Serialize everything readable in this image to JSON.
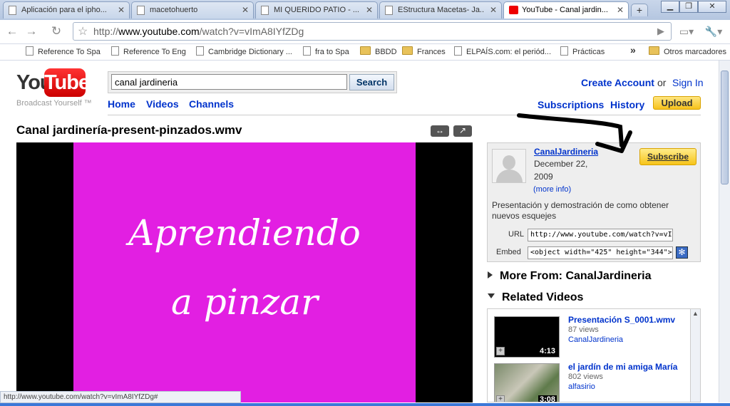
{
  "browser": {
    "tabs": [
      {
        "title": "Aplicación para el ipho...",
        "active": false
      },
      {
        "title": "macetohuerto",
        "active": false
      },
      {
        "title": "MI QUERIDO PATIO - ...",
        "active": false
      },
      {
        "title": "EStructura Macetas- Ja...",
        "active": false
      },
      {
        "title": "YouTube - Canal jardin...",
        "active": true
      }
    ],
    "new_tab_label": "+",
    "url_prefix": "http://",
    "url_domain": "www.youtube.com",
    "url_path": "/watch?v=vImA8IYfZDg",
    "bookmarks": [
      {
        "label": "Reference To Spa",
        "icon": "page-icon"
      },
      {
        "label": "Reference To Eng",
        "icon": "page-icon"
      },
      {
        "label": "Cambridge Dictionary ...",
        "icon": "page-icon"
      },
      {
        "label": "fra to Spa",
        "icon": "page-icon"
      },
      {
        "label": "BBDD",
        "icon": "folder-icon"
      },
      {
        "label": "Frances",
        "icon": "folder-icon"
      },
      {
        "label": "ELPAÍS.com: el periód...",
        "icon": "page-icon"
      },
      {
        "label": "Prácticas",
        "icon": "page-icon"
      }
    ],
    "bookmarks_overflow": "»",
    "other_bookmarks": "Otros marcadores",
    "status_text": "http://www.youtube.com/watch?v=vImA8IYfZDg#"
  },
  "youtube": {
    "logo_you": "You",
    "logo_tube": "Tube",
    "tagline": "Broadcast Yourself ™",
    "search_value": "canal jardineria",
    "search_button": "Search",
    "nav": [
      "Home",
      "Videos",
      "Channels"
    ],
    "create_account": "Create Account",
    "or": "or",
    "sign_in": "Sign In",
    "subscriptions": "Subscriptions",
    "history": "History",
    "upload": "Upload",
    "accent_color": "#0033cc",
    "upload_color": "#f7c21b"
  },
  "video": {
    "title": "Canal jardinería-present-pinzados.wmv",
    "screen_line1": "Aprendiendo",
    "screen_line2": "a pinzar",
    "screen_bg": "#e21fe2"
  },
  "channel": {
    "name": "CanalJardineria",
    "date_line1": "December 22,",
    "date_line2": "2009",
    "more_info": "(more info)",
    "description": "Presentación y demostración de como obtener nuevos esquejes",
    "subscribe": "Subscribe",
    "url_label": "URL",
    "url_value": "http://www.youtube.com/watch?v=vImA8IY",
    "embed_label": "Embed",
    "embed_value": "<object width=\"425\" height=\"344\"><param"
  },
  "sections": {
    "more_from": "More From: CanalJardineria",
    "related": "Related Videos"
  },
  "related_videos": [
    {
      "title": "Presentación S_0001.wmv",
      "views": "87 views",
      "channel": "CanalJardineria",
      "duration": "4:13"
    },
    {
      "title": "el jardín de mi amiga María",
      "views": "802 views",
      "channel": "alfasirio",
      "duration": "3:08"
    }
  ]
}
